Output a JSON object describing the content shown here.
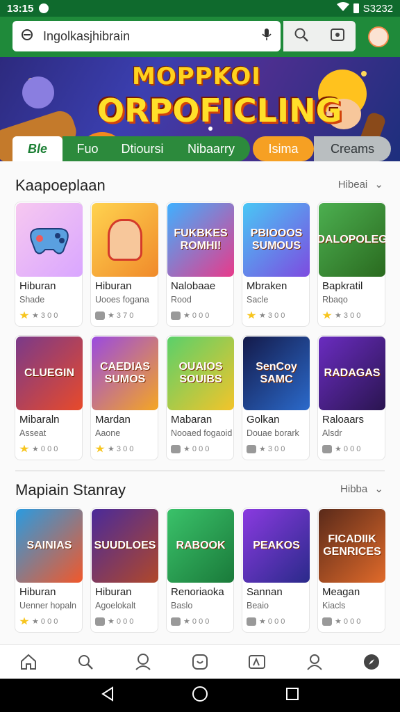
{
  "status_bar": {
    "time": "13:15",
    "battery": "S3232"
  },
  "search": {
    "value": "Ingolkasjhibrain"
  },
  "banner": {
    "line1": "MOPPKOI",
    "line2": "ORPOFICLING"
  },
  "tabs": [
    {
      "label": "Ble"
    },
    {
      "label": "Fuo"
    },
    {
      "label": "Dtioursi"
    },
    {
      "label": "Nibaarry"
    },
    {
      "label": "Isima"
    },
    {
      "label": "Creams"
    }
  ],
  "sections": [
    {
      "title": "Kaapoeplaan",
      "more": "Hibeai",
      "rows": [
        [
          {
            "art": "",
            "name": "Hiburan",
            "sub": "Shade",
            "rating": "★ 3 0 0"
          },
          {
            "art": "",
            "name": "Hiburan",
            "sub": "Uooes fogana",
            "rating": "★ 3 7 0"
          },
          {
            "art": "FUKBKES ROMHI!",
            "name": "Nalobaae",
            "sub": "Rood",
            "rating": "★ 0 0 0"
          },
          {
            "art": "PBIOOOS SUMOUS",
            "name": "Mbraken",
            "sub": "Sacle",
            "rating": "★ 3 0 0"
          },
          {
            "art": "DALOPOLEG",
            "name": "Bapkratil",
            "sub": "Rbaqo",
            "rating": "★ 3 0 0"
          }
        ],
        [
          {
            "art": "CLUEGIN",
            "name": "Mibaraln",
            "sub": "Asseat",
            "rating": "★ 0 0 0"
          },
          {
            "art": "CAEDIAS SUMOS",
            "name": "Mardan",
            "sub": "Aaone",
            "rating": "★ 3 0 0"
          },
          {
            "art": "OUAIOS SOUIBS",
            "name": "Mabaran",
            "sub": "Nooaed fogaoid",
            "rating": "★ 0 0 0"
          },
          {
            "art": "SenCoy SAMC",
            "name": "Golkan",
            "sub": "Douae borark",
            "rating": "★ 3 0 0"
          },
          {
            "art": "RADAGAS",
            "name": "Raloaars",
            "sub": "Alsdr",
            "rating": "★ 0 0 0"
          }
        ]
      ]
    },
    {
      "title": "Mapiain Stanray",
      "more": "Hibba",
      "rows": [
        [
          {
            "art": "SAINIAS",
            "name": "Hiburan",
            "sub": "Uenner hopaln",
            "rating": "★ 0 0 0"
          },
          {
            "art": "SUUDLOES",
            "name": "Hiburan",
            "sub": "Agoelokalt",
            "rating": "★ 0 0 0"
          },
          {
            "art": "RABOOK",
            "name": "Renoriaoka",
            "sub": "Baslo",
            "rating": "★ 0 0 0"
          },
          {
            "art": "PEAKOS",
            "name": "Sannan",
            "sub": "Beaio",
            "rating": "★ 0 0 0"
          },
          {
            "art": "FICADIIK GENRICES",
            "name": "Meagan",
            "sub": "Kiacls",
            "rating": "★ 0 0 0"
          }
        ]
      ]
    }
  ],
  "colors": {
    "header_green": "#1f8a3a",
    "tab_orange": "#f6a023",
    "star_yellow": "#f7c51e"
  }
}
